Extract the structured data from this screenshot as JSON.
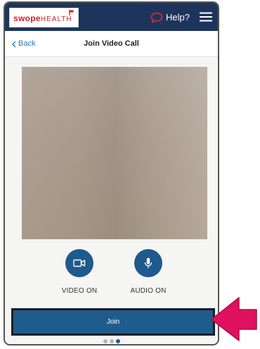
{
  "brand": {
    "logo_part1": "swope",
    "logo_part2": "HEALTH",
    "color": "#d32027"
  },
  "appbar": {
    "background": "#1d355c",
    "help_label": "Help?",
    "help_icon": "chat-bubble-icon",
    "menu_icon": "hamburger-menu-icon"
  },
  "subheader": {
    "back_label": "Back",
    "title": "Join Video Call"
  },
  "controls": {
    "video": {
      "label": "VIDEO ON",
      "icon": "video-camera-icon"
    },
    "audio": {
      "label": "AUDIO ON",
      "icon": "microphone-icon"
    }
  },
  "join": {
    "label": "Join",
    "color": "#1f5c8e"
  },
  "pager": {
    "count": 3,
    "active_index": 2
  },
  "annotation": {
    "arrow_color": "#e0115f"
  }
}
